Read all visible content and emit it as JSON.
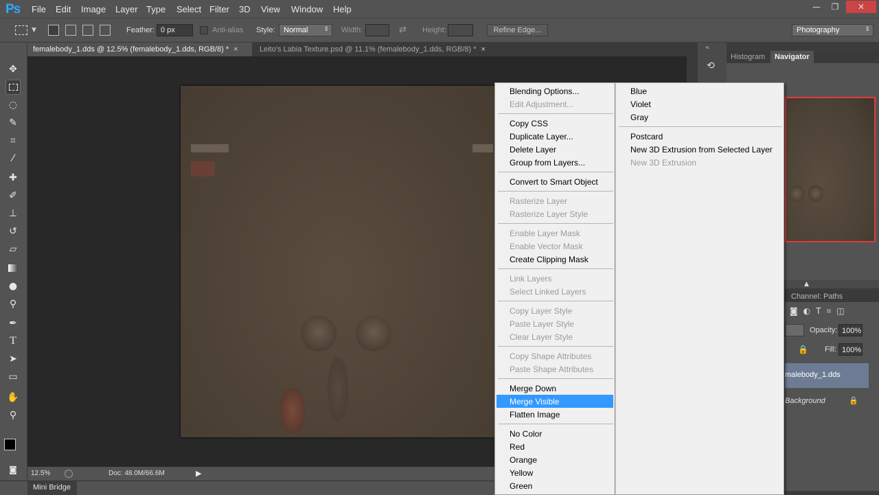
{
  "app": {
    "logo": "Ps"
  },
  "menubar": {
    "items": [
      "File",
      "Edit",
      "Image",
      "Layer",
      "Type",
      "Select",
      "Filter",
      "3D",
      "View",
      "Window",
      "Help"
    ]
  },
  "window_controls": {
    "minimize": "—",
    "restore": "❐",
    "close": "✕"
  },
  "options": {
    "feather_label": "Feather:",
    "feather_value": "0 px",
    "antialias_label": "Anti-alias",
    "style_label": "Style:",
    "style_value": "Normal",
    "width_label": "Width:",
    "height_label": "Height:",
    "refine_edge": "Refine Edge...",
    "workspace": "Photography"
  },
  "tabs": [
    {
      "label": "femalebody_1.dds @ 12.5% (femalebody_1.dds, RGB/8) *",
      "close": "×"
    },
    {
      "label": "Leito's Labia Texture.psd @ 11.1% (femalebody_1.dds, RGB/8) *",
      "close": "×"
    }
  ],
  "status": {
    "zoom": "12.5%",
    "doc": "Doc: 48.0M/66.6M"
  },
  "minibridge": {
    "label": "Mini Bridge"
  },
  "panels": {
    "histogram": "Histogram",
    "navigator": "Navigator",
    "channels": "Channel:",
    "paths": "Paths",
    "opacity_label": "Opacity:",
    "opacity_value": "100%",
    "fill_label": "Fill:",
    "fill_value": "100%",
    "layers": [
      "malebody_1.dds",
      "Background"
    ]
  },
  "context_menu": {
    "col1": [
      {
        "label": "Blending Options...",
        "enabled": true
      },
      {
        "label": "Edit Adjustment...",
        "enabled": false
      },
      {
        "sep": true
      },
      {
        "label": "Copy CSS",
        "enabled": true
      },
      {
        "label": "Duplicate Layer...",
        "enabled": true
      },
      {
        "label": "Delete Layer",
        "enabled": true
      },
      {
        "label": "Group from Layers...",
        "enabled": true
      },
      {
        "sep": true
      },
      {
        "label": "Convert to Smart Object",
        "enabled": true
      },
      {
        "sep": true
      },
      {
        "label": "Rasterize Layer",
        "enabled": false
      },
      {
        "label": "Rasterize Layer Style",
        "enabled": false
      },
      {
        "sep": true
      },
      {
        "label": "Enable Layer Mask",
        "enabled": false
      },
      {
        "label": "Enable Vector Mask",
        "enabled": false
      },
      {
        "label": "Create Clipping Mask",
        "enabled": true
      },
      {
        "sep": true
      },
      {
        "label": "Link Layers",
        "enabled": false
      },
      {
        "label": "Select Linked Layers",
        "enabled": false
      },
      {
        "sep": true
      },
      {
        "label": "Copy Layer Style",
        "enabled": false
      },
      {
        "label": "Paste Layer Style",
        "enabled": false
      },
      {
        "label": "Clear Layer Style",
        "enabled": false
      },
      {
        "sep": true
      },
      {
        "label": "Copy Shape Attributes",
        "enabled": false
      },
      {
        "label": "Paste Shape Attributes",
        "enabled": false
      },
      {
        "sep": true
      },
      {
        "label": "Merge Down",
        "enabled": true
      },
      {
        "label": "Merge Visible",
        "enabled": true,
        "highlighted": true
      },
      {
        "label": "Flatten Image",
        "enabled": true
      },
      {
        "sep": true
      },
      {
        "label": "No Color",
        "enabled": true
      },
      {
        "label": "Red",
        "enabled": true
      },
      {
        "label": "Orange",
        "enabled": true
      },
      {
        "label": "Yellow",
        "enabled": true
      },
      {
        "label": "Green",
        "enabled": true
      }
    ],
    "col2": [
      {
        "label": "Blue",
        "enabled": true
      },
      {
        "label": "Violet",
        "enabled": true
      },
      {
        "label": "Gray",
        "enabled": true
      },
      {
        "sep": true
      },
      {
        "label": "Postcard",
        "enabled": true
      },
      {
        "label": "New 3D Extrusion from Selected Layer",
        "enabled": true
      },
      {
        "label": "New 3D Extrusion",
        "enabled": false
      }
    ]
  },
  "colors": {
    "accent": "#3399ff",
    "navigator_frame": "#e33a3a",
    "logo": "#31a8ff"
  }
}
